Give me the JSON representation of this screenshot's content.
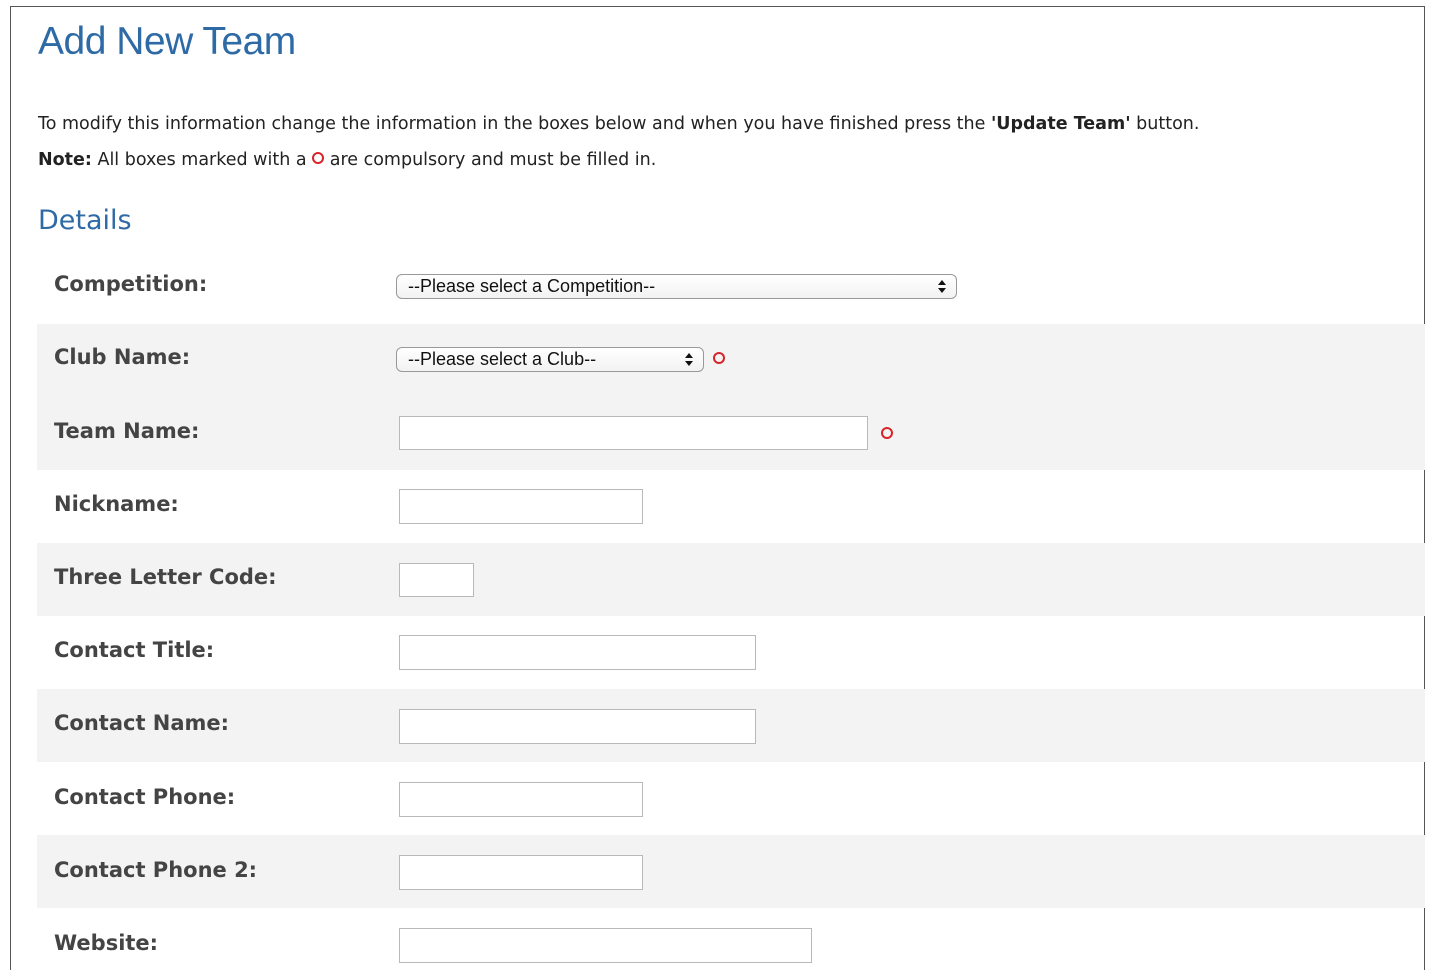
{
  "page": {
    "title": "Add New Team",
    "intro_text": "To modify this information change the information in the boxes below and when you have finished press the ",
    "intro_button_name": "'Update Team'",
    "intro_end": " button.",
    "note_label": "Note:",
    "note_text_before": " All boxes marked with a ",
    "note_text_after": " are compulsory and must be filled in.",
    "required_color": "#d8232a",
    "accent_color": "#2e6aa5"
  },
  "details": {
    "section_title": "Details",
    "competition": {
      "label": "Competition:",
      "value": "--Please select a Competition--",
      "required": false
    },
    "club_name": {
      "label": "Club Name:",
      "value": "--Please select a Club--",
      "required": true
    },
    "team_name": {
      "label": "Team Name:",
      "value": "",
      "required": true
    },
    "nickname": {
      "label": "Nickname:",
      "value": ""
    },
    "three_letter_code": {
      "label": "Three Letter Code:",
      "value": ""
    },
    "contact_title": {
      "label": "Contact Title:",
      "value": ""
    },
    "contact_name": {
      "label": "Contact Name:",
      "value": ""
    },
    "contact_phone": {
      "label": "Contact Phone:",
      "value": ""
    },
    "contact_phone_2": {
      "label": "Contact Phone 2:",
      "value": ""
    },
    "website": {
      "label": "Website:",
      "value": ""
    }
  }
}
